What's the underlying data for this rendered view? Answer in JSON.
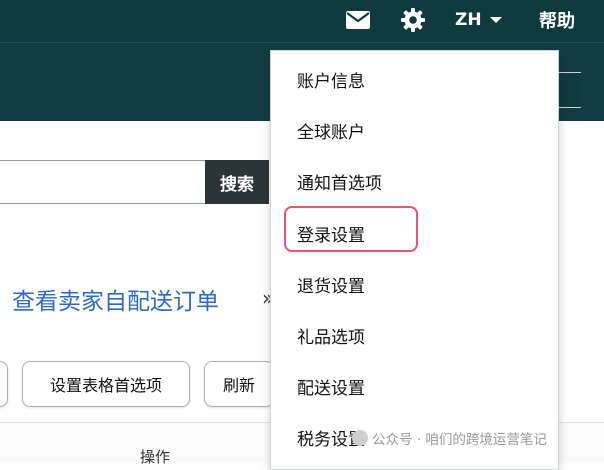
{
  "header": {
    "lang": "ZH",
    "help": "帮助",
    "icons": {
      "mail": "mail-icon",
      "settings": "gear-icon",
      "caret": "chevron-down-icon"
    }
  },
  "search": {
    "button_label": "搜索",
    "value": ""
  },
  "page": {
    "title": "查看卖家自配送订单",
    "title_suffix": "»"
  },
  "toolbar": {
    "prefs_label": "设置表格首选项",
    "refresh_label": "刷新"
  },
  "table": {
    "header_action": "操作"
  },
  "settings_menu": {
    "items": [
      {
        "label": "账户信息"
      },
      {
        "label": "全球账户"
      },
      {
        "label": "通知首选项"
      },
      {
        "label": "登录设置",
        "highlighted": true
      },
      {
        "label": "退货设置"
      },
      {
        "label": "礼品选项"
      },
      {
        "label": "配送设置"
      },
      {
        "label": "税务设置"
      }
    ],
    "highlight_color": "#e8566d"
  },
  "watermark": {
    "text": "公众号 · 咱们的跨境运营笔记"
  },
  "colors": {
    "header_bg": "#0f3b40",
    "link": "#2a6ad0",
    "search_btn_bg": "#2b3438"
  }
}
